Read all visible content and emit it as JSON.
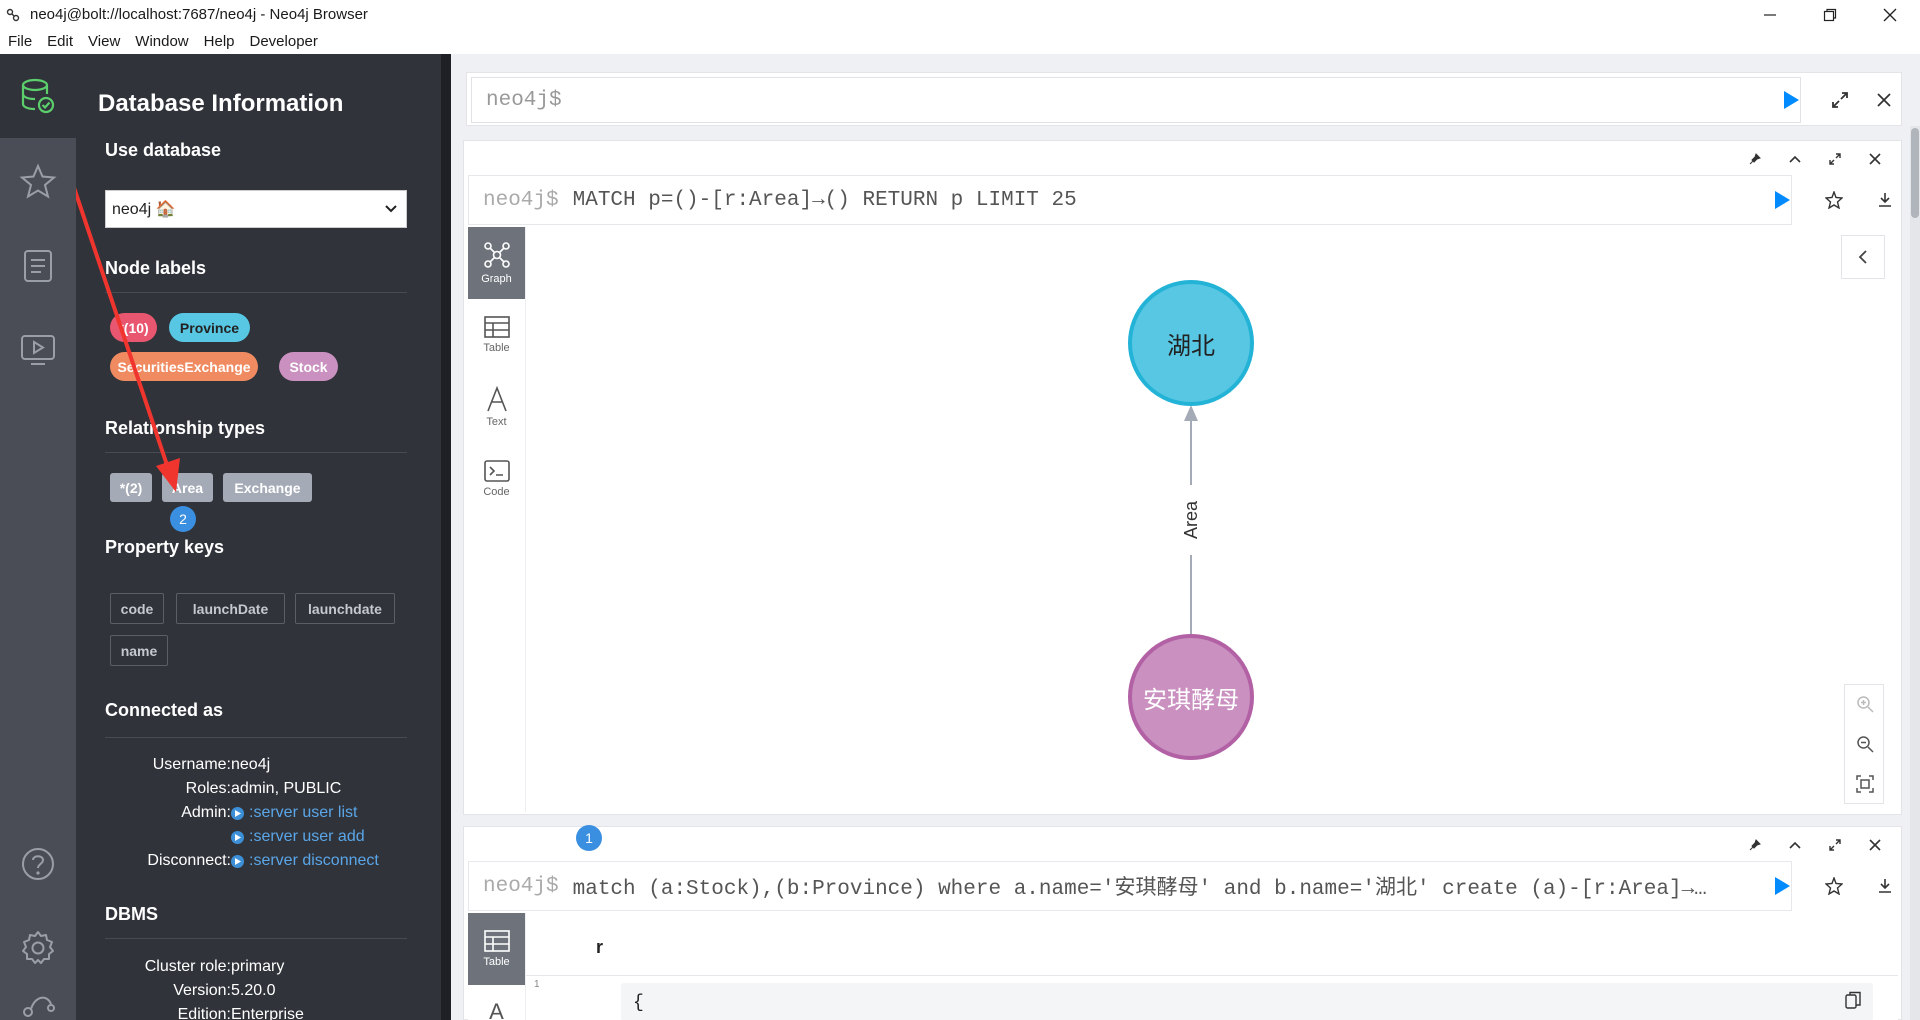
{
  "window": {
    "title": "neo4j@bolt://localhost:7687/neo4j - Neo4j Browser"
  },
  "menu": [
    "File",
    "Edit",
    "View",
    "Window",
    "Help",
    "Developer"
  ],
  "drawer": {
    "title": "Database Information",
    "use_database": {
      "heading": "Use database",
      "selected": "neo4j 🏠"
    },
    "node_labels": {
      "heading": "Node labels",
      "items": [
        {
          "label": "*(10)",
          "color": "#e8566f"
        },
        {
          "label": "Province",
          "color": "#57c7e3"
        },
        {
          "label": "SecuritiesExchange",
          "color": "#f16667"
        },
        {
          "label": "Stock",
          "color": "#c990c0"
        }
      ]
    },
    "relationship_types": {
      "heading": "Relationship types",
      "items": [
        "*(2)",
        "Area",
        "Exchange"
      ],
      "annotation_badge": "2"
    },
    "property_keys": {
      "heading": "Property keys",
      "items": [
        "code",
        "launchDate",
        "launchdate",
        "name"
      ]
    },
    "connected_as": {
      "heading": "Connected as",
      "username_label": "Username:",
      "username": "neo4j",
      "roles_label": "Roles:",
      "roles": "admin, PUBLIC",
      "admin_label": "Admin:",
      "admin_links": [
        ":server user list",
        ":server user add"
      ],
      "disconnect_label": "Disconnect:",
      "disconnect_link": ":server disconnect"
    },
    "dbms": {
      "heading": "DBMS",
      "cluster_role_label": "Cluster role:",
      "cluster_role": "primary",
      "version_label": "Version:",
      "version": "5.20.0",
      "edition_label": "Edition:",
      "edition": "Enterprise"
    }
  },
  "editor": {
    "prompt": "neo4j$"
  },
  "frame1": {
    "prompt": "neo4j$",
    "query": "MATCH p=()-[r:Area]→() RETURN p LIMIT 25",
    "tabs": [
      "Graph",
      "Table",
      "Text",
      "Code"
    ],
    "nodes": [
      {
        "label": "湖北",
        "color": "#57c7e3",
        "border": "#23b3d7"
      },
      {
        "label": "安琪酵母",
        "color": "#c990c0",
        "border": "#b261a5"
      }
    ],
    "relationship": "Area"
  },
  "frame2": {
    "badge": "1",
    "prompt": "neo4j$",
    "query": "match (a:Stock),(b:Province) where a.name='安琪酵母' and b.name='湖北' create (a)-[r:Area]→…",
    "tabs": [
      "Table",
      "A"
    ],
    "column": "r",
    "row_number": "1",
    "code_open": "{"
  },
  "colors": {
    "accent_play": "#018bff",
    "sidebar": "#4a4d55",
    "drawer": "#30333a",
    "active_icon": "#5ccf6c"
  }
}
